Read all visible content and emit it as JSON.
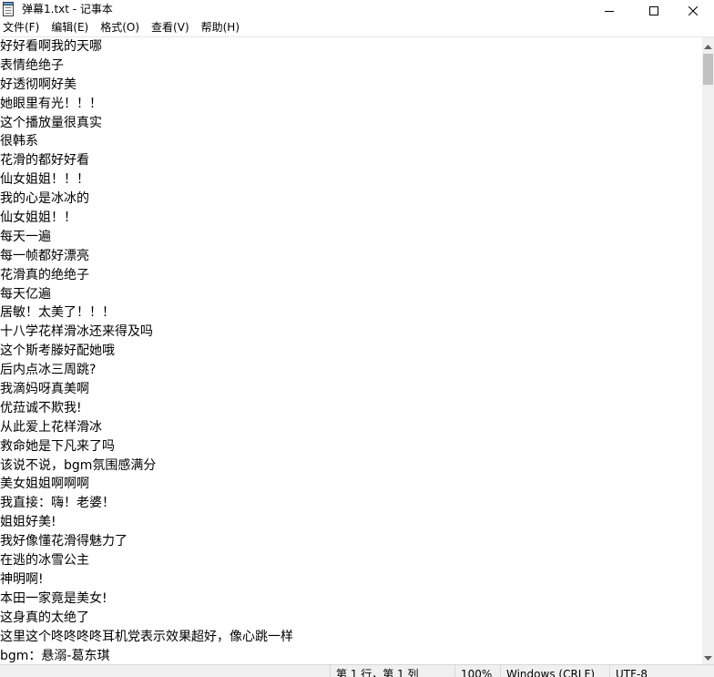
{
  "window": {
    "title": "弹幕1.txt - 记事本",
    "icon": "notepad-icon",
    "controls": {
      "minimize_icon": "minimize-icon",
      "maximize_icon": "maximize-icon",
      "close_icon": "close-icon"
    }
  },
  "menu": {
    "items": [
      {
        "label": "文件(F)"
      },
      {
        "label": "编辑(E)"
      },
      {
        "label": "格式(O)"
      },
      {
        "label": "查看(V)"
      },
      {
        "label": "帮助(H)"
      }
    ]
  },
  "editor": {
    "lines": [
      "好好看啊我的天哪",
      "表情绝绝子",
      "好透彻啊好美",
      "她眼里有光！！！",
      "这个播放量很真实",
      "很韩系",
      "花滑的都好好看",
      "仙女姐姐！！！",
      "我的心是冰冰的",
      "仙女姐姐！！",
      "每天一遍",
      "每一帧都好漂亮",
      "花滑真的绝绝子",
      "每天亿遍",
      "居敏！太美了！！！",
      "十八学花样滑冰还来得及吗",
      "这个斯考滕好配她哦",
      "后内点冰三周跳?",
      "我滴妈呀真美啊",
      "优菈诚不欺我!",
      "从此爱上花样滑冰",
      "救命她是下凡来了吗",
      "该说不说，bgm氛围感满分",
      "美女姐姐啊啊啊",
      "我直接：嗨！老婆！",
      "姐姐好美!",
      "我好像懂花滑得魅力了",
      "在逃的冰雪公主",
      "神明啊!",
      "本田一家竟是美女!",
      "这身真的太绝了",
      "这里这个咚咚咚咚耳机党表示效果超好，像心跳一样",
      "bgm：悬溺-葛东琪"
    ]
  },
  "scrollbar": {
    "up_icon": "scroll-up-arrow-icon",
    "down_icon": "scroll-down-arrow-icon"
  },
  "status": {
    "position": "第 1 行，第 1 列",
    "zoom": "100%",
    "line_ending": "Windows (CRLF)",
    "encoding": "UTF-8"
  }
}
